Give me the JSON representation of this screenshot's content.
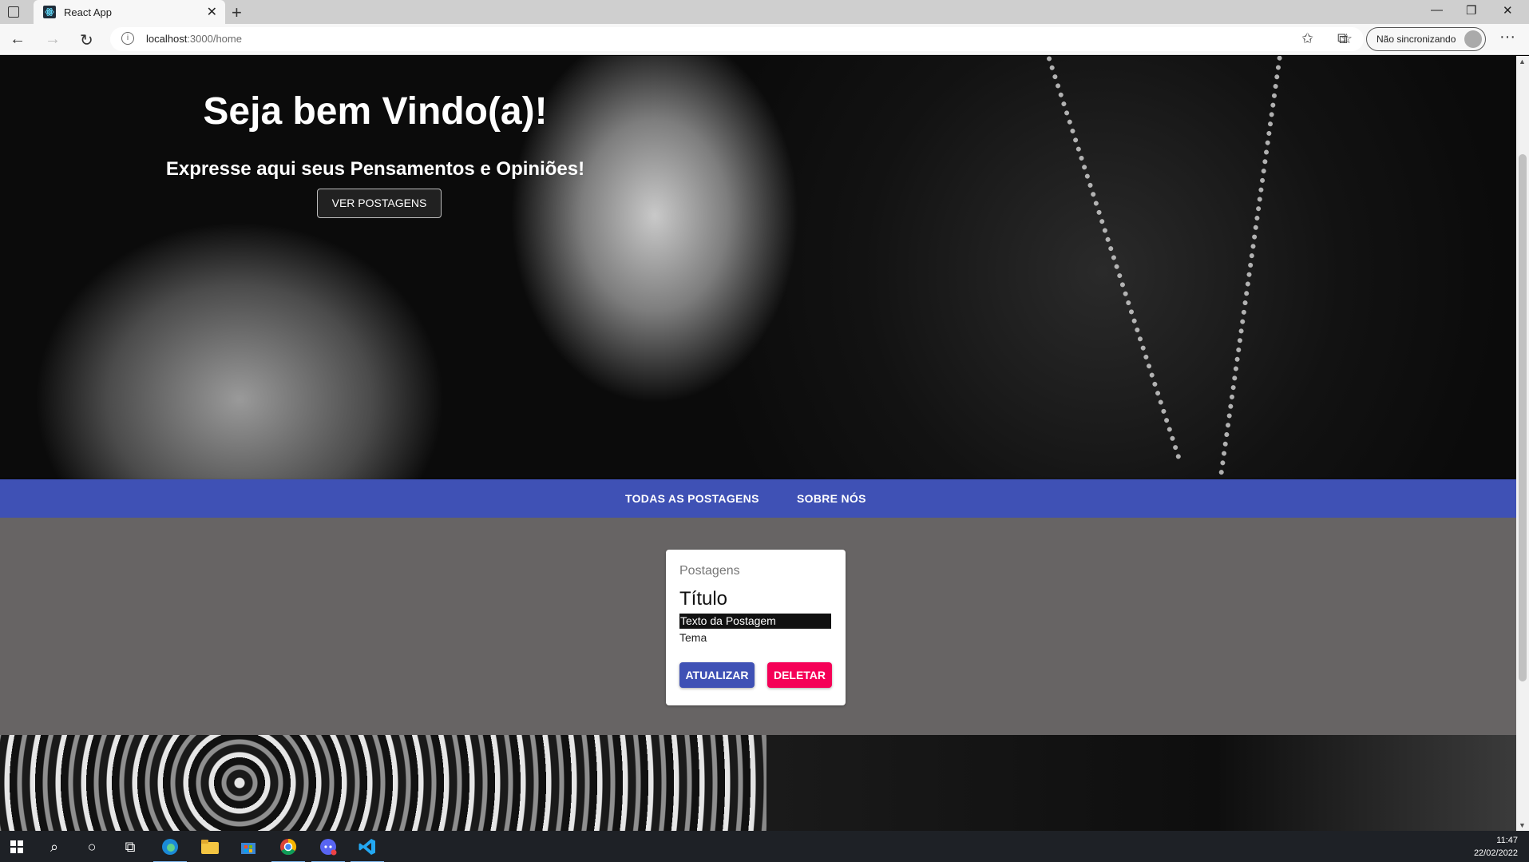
{
  "browser": {
    "tab_title": "React App",
    "tab_close": "✕",
    "new_tab": "+",
    "url_host": "localhost",
    "url_rest": ":3000/home",
    "profile_status": "Não sincronizando",
    "more": "···"
  },
  "hero": {
    "title": "Seja bem Vindo(a)!",
    "subtitle": "Expresse aqui seus Pensamentos e Opiniões!",
    "button": "VER POSTAGENS"
  },
  "menu": {
    "items": [
      "TODAS AS POSTAGENS",
      "SOBRE NÓS"
    ]
  },
  "card": {
    "label": "Postagens",
    "title": "Título",
    "text": "Texto da Postagem",
    "theme": "Tema",
    "update": "ATUALIZAR",
    "delete": "DELETAR"
  },
  "colors": {
    "primary": "#3f51b5",
    "secondary": "#f50057",
    "content_bg": "#676464"
  },
  "taskbar": {
    "time": "11:47",
    "date": "22/02/2022",
    "icons": [
      "windows-start-icon",
      "search-icon",
      "cortana-icon",
      "task-view-icon",
      "edge-icon",
      "file-explorer-icon",
      "store-icon",
      "chrome-icon",
      "discord-icon",
      "vscode-icon"
    ]
  }
}
